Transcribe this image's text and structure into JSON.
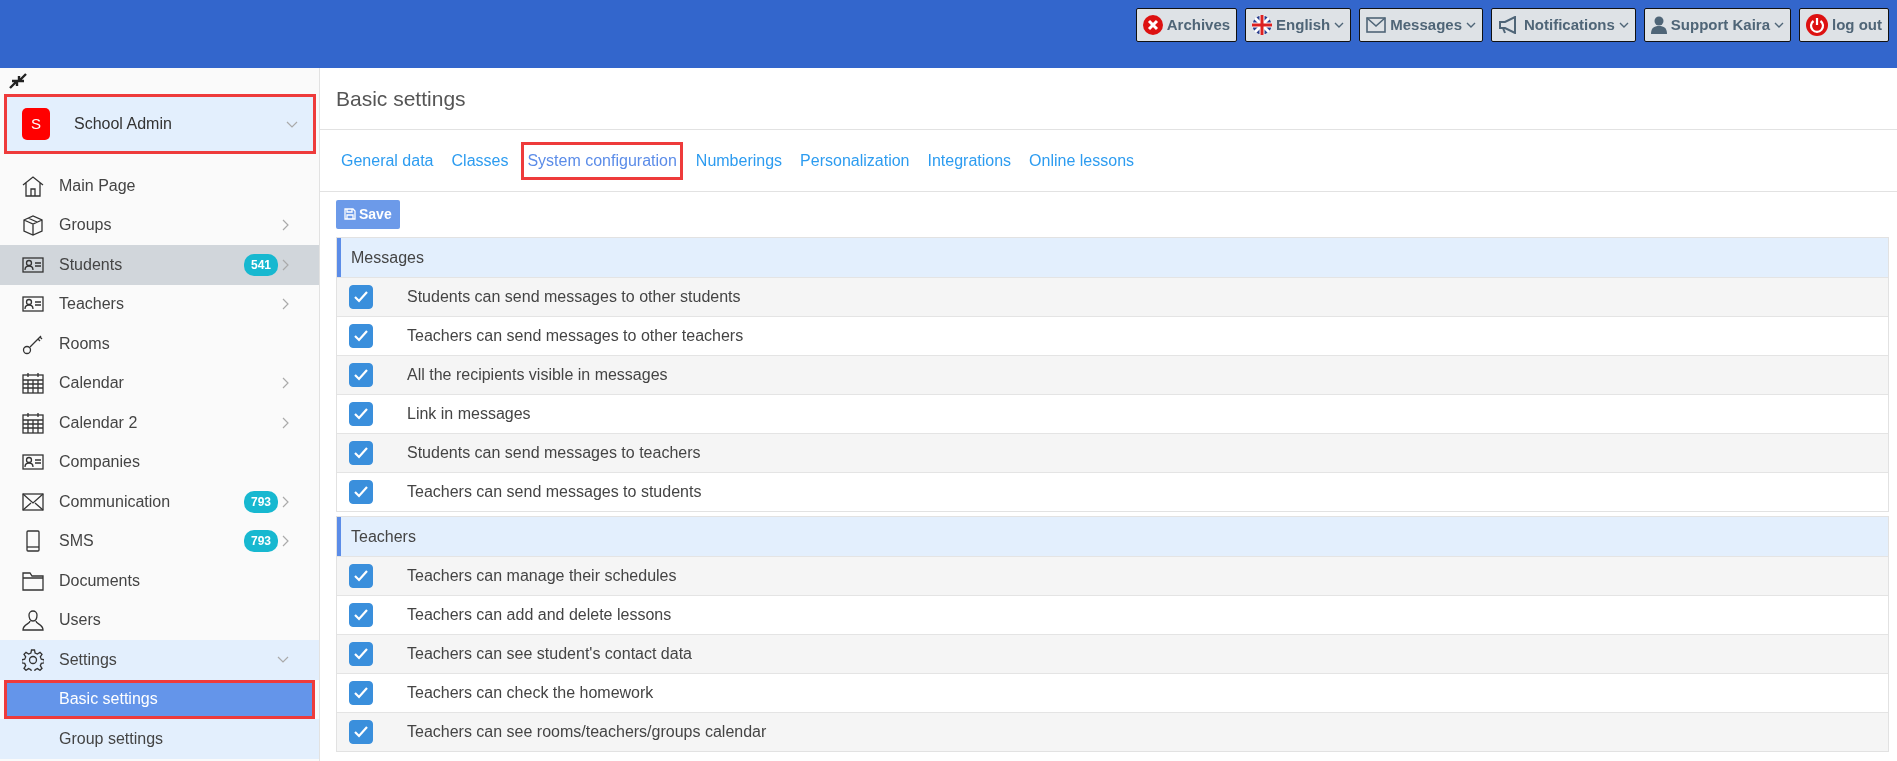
{
  "top_buttons": [
    {
      "label": "Archives",
      "kind": "archive",
      "dropdown": false
    },
    {
      "label": "English",
      "kind": "flag",
      "dropdown": true
    },
    {
      "label": "Messages",
      "kind": "envelope",
      "dropdown": true
    },
    {
      "label": "Notifications",
      "kind": "megaphone",
      "dropdown": true
    },
    {
      "label": "Support Kaira",
      "kind": "user",
      "dropdown": true
    },
    {
      "label": "log out",
      "kind": "power",
      "dropdown": false
    }
  ],
  "sidebar": {
    "school": {
      "initial": "S",
      "name": "School Admin",
      "highlighted": true
    },
    "items": [
      {
        "label": "Main Page",
        "has_arrow": false,
        "selected": false,
        "expanded": false
      },
      {
        "label": "Groups",
        "has_arrow": true,
        "selected": false,
        "expanded": false
      },
      {
        "label": "Students",
        "badge": "541",
        "has_arrow": true,
        "selected": true,
        "expanded": false
      },
      {
        "label": "Teachers",
        "has_arrow": true,
        "selected": false,
        "expanded": false
      },
      {
        "label": "Rooms",
        "has_arrow": false,
        "selected": false,
        "expanded": false
      },
      {
        "label": "Calendar",
        "has_arrow": true,
        "selected": false,
        "expanded": false
      },
      {
        "label": "Calendar 2",
        "has_arrow": true,
        "selected": false,
        "expanded": false
      },
      {
        "label": "Companies",
        "has_arrow": false,
        "selected": false,
        "expanded": false
      },
      {
        "label": "Communication",
        "badge": "793",
        "has_arrow": true,
        "selected": false,
        "expanded": false
      },
      {
        "label": "SMS",
        "badge": "793",
        "has_arrow": true,
        "selected": false,
        "expanded": false
      },
      {
        "label": "Documents",
        "has_arrow": false,
        "selected": false,
        "expanded": false
      },
      {
        "label": "Users",
        "has_arrow": false,
        "selected": false,
        "expanded": false
      },
      {
        "label": "Settings",
        "has_arrow": true,
        "selected": false,
        "expanded": true,
        "children": [
          {
            "label": "Basic settings",
            "selected": true,
            "highlighted": true
          },
          {
            "label": "Group settings",
            "selected": false,
            "highlighted": false
          }
        ]
      }
    ]
  },
  "page_title": "Basic settings",
  "tabs": [
    {
      "label": "General data",
      "selected": false
    },
    {
      "label": "Classes",
      "selected": false
    },
    {
      "label": "System configuration",
      "selected": true
    },
    {
      "label": "Numberings",
      "selected": false
    },
    {
      "label": "Personalization",
      "selected": false
    },
    {
      "label": "Integrations",
      "selected": false
    },
    {
      "label": "Online lessons",
      "selected": false
    }
  ],
  "save_button": "Save",
  "sections": [
    {
      "title": "Messages",
      "options": [
        {
          "label": "Students can send messages to other students",
          "checked": true
        },
        {
          "label": "Teachers can send messages to other teachers",
          "checked": true
        },
        {
          "label": "All the recipients visible in messages",
          "checked": true
        },
        {
          "label": "Link in messages",
          "checked": true
        },
        {
          "label": "Students can send messages to teachers",
          "checked": true
        },
        {
          "label": "Teachers can send messages to students",
          "checked": true
        }
      ]
    },
    {
      "title": "Teachers",
      "options": [
        {
          "label": "Teachers can manage their schedules",
          "checked": true
        },
        {
          "label": "Teachers can add and delete lessons",
          "checked": true
        },
        {
          "label": "Teachers can see student's contact data",
          "checked": true
        },
        {
          "label": "Teachers can check the homework",
          "checked": true
        },
        {
          "label": "Teachers can see rooms/teachers/groups calendar",
          "checked": true
        }
      ]
    }
  ]
}
